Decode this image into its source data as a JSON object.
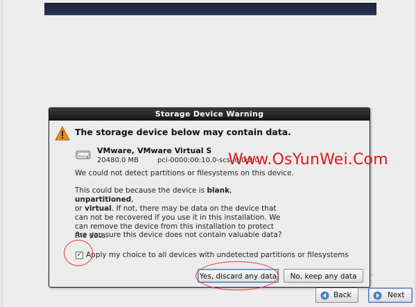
{
  "installer": {
    "back_label": "Back",
    "next_label": "Next"
  },
  "dialog": {
    "title": "Storage Device Warning",
    "heading": "The storage device below may contain data.",
    "device": {
      "name": "VMware, VMware Virtual S",
      "size": "20480.0 MB",
      "path": "pci-0000:00:10.0-scsi-0:0:0:0"
    },
    "no_partitions_text": "We could not detect partitions or filesystems on this device.",
    "reason": {
      "part1": "This could be because the device is ",
      "blank": "blank",
      "comma1": ", ",
      "unpartitioned": "unpartitioned",
      "comma2": ",",
      "or": "or ",
      "virtual": "virtual",
      "rest": ". If not, there may be data on the device that can not be recovered if you use it in this installation. We can remove the device from this installation to protect the data."
    },
    "confirm_question": "Are you sure this device does not contain valuable data?",
    "apply_all": {
      "checked": true,
      "mark": "✓",
      "label": "Apply my choice to all devices with undetected partitions or filesystems"
    },
    "yes_button": "Yes, discard any data",
    "no_button": "No, keep any data"
  },
  "watermark": "Www.OsYunWei.Com",
  "colors": {
    "annotation_red": "#e23434",
    "watermark_red": "#e01818",
    "warning_orange": "#f08a1c",
    "focus_blue": "#4a74b5"
  },
  "icons": {
    "warning": "warning-icon",
    "disk": "hard-disk-icon",
    "back": "back-arrow-icon",
    "next": "next-arrow-icon"
  }
}
